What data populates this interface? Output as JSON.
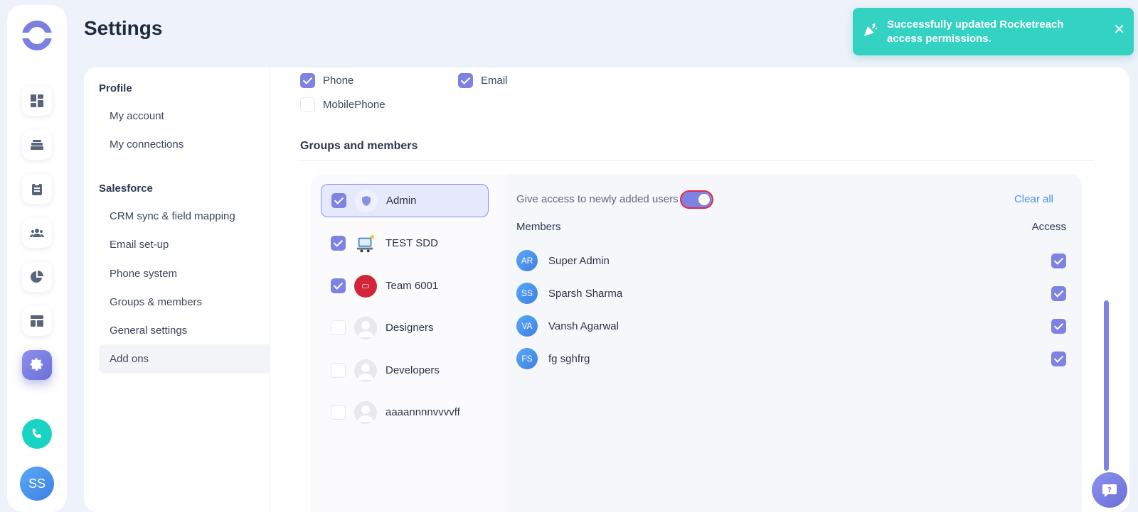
{
  "page": {
    "title": "Settings"
  },
  "rail": {
    "avatar_initials": "SS",
    "items": [
      "dashboard-icon",
      "inbox-icon",
      "clipboard-icon",
      "people-icon",
      "pie-chart-icon",
      "layout-icon",
      "settings-icon"
    ]
  },
  "sidebar": {
    "sections": [
      {
        "heading": "Profile",
        "items": [
          "My account",
          "My connections"
        ]
      },
      {
        "heading": "Salesforce",
        "items": [
          "CRM sync & field mapping",
          "Email set-up",
          "Phone system",
          "Groups & members",
          "General settings",
          "Add ons"
        ]
      }
    ],
    "active_item": "Add ons"
  },
  "fields": {
    "phone": {
      "label": "Phone",
      "checked": true
    },
    "email": {
      "label": "Email",
      "checked": true
    },
    "mobile": {
      "label": "MobilePhone",
      "checked": false
    }
  },
  "groups_section": {
    "title": "Groups and members",
    "groups": [
      {
        "name": "Admin",
        "checked": true,
        "selected": true
      },
      {
        "name": "TEST SDD",
        "checked": true
      },
      {
        "name": "Team 6001",
        "checked": true
      },
      {
        "name": "Designers",
        "checked": false
      },
      {
        "name": "Developers",
        "checked": false
      },
      {
        "name": "aaaannnnvvvvff",
        "checked": false
      }
    ],
    "give_access_label": "Give access to newly added users",
    "give_access_on": true,
    "clear_all": "Clear all",
    "members_header": "Members",
    "access_header": "Access",
    "members": [
      {
        "initials": "AR",
        "name": "Super Admin",
        "access": true
      },
      {
        "initials": "SS",
        "name": "Sparsh Sharma",
        "access": true
      },
      {
        "initials": "VA",
        "name": "Vansh Agarwal",
        "access": true
      },
      {
        "initials": "FS",
        "name": "fg sghfrg",
        "access": true
      }
    ]
  },
  "toast": {
    "message": "Successfully updated Rocketreach access permissions."
  },
  "colors": {
    "accent": "#7d82e3",
    "toast": "#33d2c3",
    "phone": "#19d3c5",
    "link": "#4b8fe0"
  }
}
